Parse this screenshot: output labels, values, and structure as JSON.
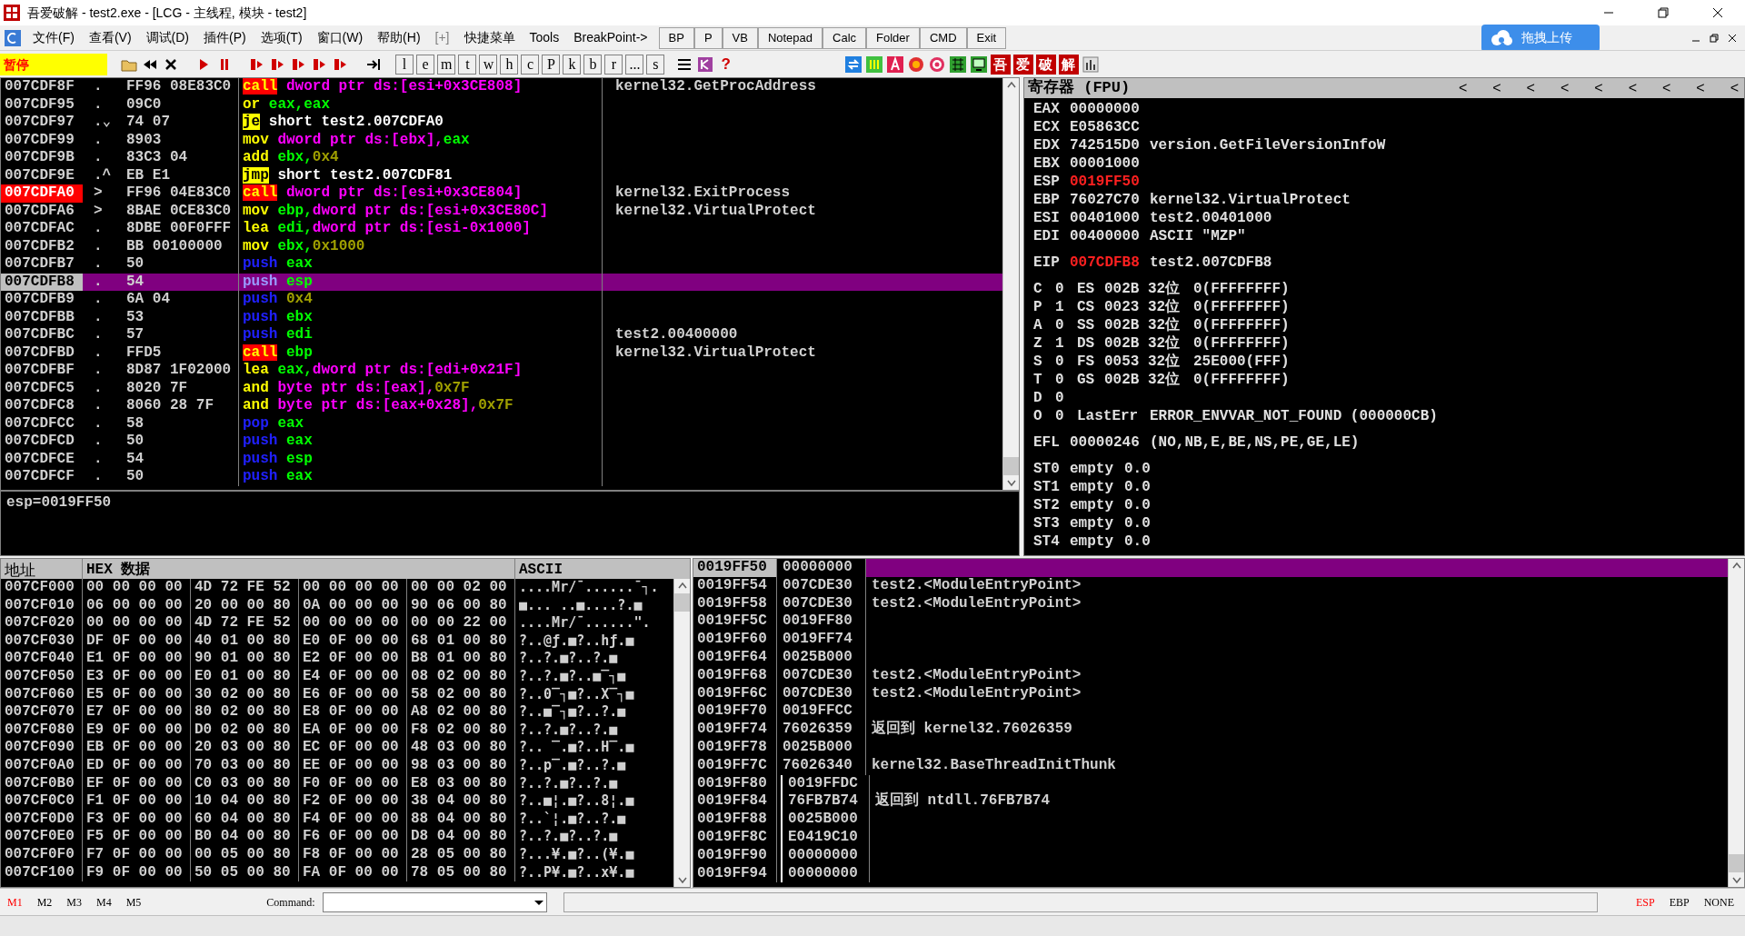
{
  "window": {
    "title": "吾爱破解 - test2.exe - [LCG - 主线程, 模块 - test2]"
  },
  "menu": [
    "文件(F)",
    "查看(V)",
    "调试(D)",
    "插件(P)",
    "选项(T)",
    "窗口(W)",
    "帮助(H)",
    "[+]",
    "快捷菜单",
    "Tools",
    "BreakPoint->"
  ],
  "tool_buttons": [
    "BP",
    "P",
    "VB",
    "Notepad",
    "Calc",
    "Folder",
    "CMD",
    "Exit"
  ],
  "upload_button": "拖拽上传",
  "status": "暂停",
  "letter_buttons": [
    "l",
    "e",
    "m",
    "t",
    "w",
    "h",
    "c",
    "P",
    "k",
    "b",
    "r",
    "...",
    "s"
  ],
  "help_button": "?",
  "cjk_buttons": [
    "吾",
    "爱",
    "破",
    "解"
  ],
  "disassembly": [
    {
      "address": "007CDF8F",
      "mark": ".",
      "hex": "FF96 08E83C0",
      "code": [
        {
          "kind": "call",
          "text": "call"
        },
        {
          "kind": "mem",
          "text": " dword ptr ds:[esi+0x3CE808]"
        }
      ],
      "comment": "kernel32.GetProcAddress",
      "selected": false,
      "breakpoint": false
    },
    {
      "address": "007CDF95",
      "mark": ".",
      "hex": "09C0",
      "code": [
        {
          "kind": "op",
          "text": "or"
        },
        {
          "kind": "reg",
          "text": " eax,eax"
        }
      ],
      "selected": false,
      "breakpoint": false
    },
    {
      "address": "007CDF97",
      "mark": ".⌄",
      "hex": "74 07",
      "code": [
        {
          "kind": "jump",
          "text": "je"
        },
        {
          "kind": "sym",
          "text": " short test2.007CDFA0"
        }
      ],
      "selected": false,
      "breakpoint": false
    },
    {
      "address": "007CDF99",
      "mark": ".",
      "hex": "8903",
      "code": [
        {
          "kind": "op",
          "text": "mov"
        },
        {
          "kind": "mem",
          "text": " dword ptr ds:[ebx],"
        },
        {
          "kind": "reg",
          "text": "eax"
        }
      ],
      "selected": false,
      "breakpoint": false
    },
    {
      "address": "007CDF9B",
      "mark": ".",
      "hex": "83C3 04",
      "code": [
        {
          "kind": "op",
          "text": "add"
        },
        {
          "kind": "reg",
          "text": " ebx,"
        },
        {
          "kind": "imm",
          "text": "0x4"
        }
      ],
      "selected": false,
      "breakpoint": false
    },
    {
      "address": "007CDF9E",
      "mark": ".^",
      "hex": "EB E1",
      "code": [
        {
          "kind": "jump",
          "text": "jmp"
        },
        {
          "kind": "sym",
          "text": " short test2.007CDF81"
        }
      ],
      "selected": false,
      "breakpoint": false
    },
    {
      "address": "007CDFA0",
      "mark": ">",
      "hex": "FF96 04E83C0",
      "code": [
        {
          "kind": "call",
          "text": "call"
        },
        {
          "kind": "mem",
          "text": " dword ptr ds:[esi+0x3CE804]"
        }
      ],
      "comment": "kernel32.ExitProcess",
      "selected": false,
      "breakpoint": true
    },
    {
      "address": "007CDFA6",
      "mark": ">",
      "hex": "8BAE 0CE83C0",
      "code": [
        {
          "kind": "op",
          "text": "mov"
        },
        {
          "kind": "reg",
          "text": " ebp,"
        },
        {
          "kind": "mem",
          "text": "dword ptr ds:[esi+0x3CE80C]"
        }
      ],
      "comment": "kernel32.VirtualProtect",
      "selected": false,
      "breakpoint": false
    },
    {
      "address": "007CDFAC",
      "mark": ".",
      "hex": "8DBE 00F0FFF",
      "code": [
        {
          "kind": "op",
          "text": "lea"
        },
        {
          "kind": "reg",
          "text": " edi,"
        },
        {
          "kind": "mem",
          "text": "dword ptr ds:[esi-0x1000]"
        }
      ],
      "selected": false,
      "breakpoint": false
    },
    {
      "address": "007CDFB2",
      "mark": ".",
      "hex": "BB 00100000",
      "code": [
        {
          "kind": "op",
          "text": "mov"
        },
        {
          "kind": "reg",
          "text": " ebx,"
        },
        {
          "kind": "imm",
          "text": "0x1000"
        }
      ],
      "selected": false,
      "breakpoint": false
    },
    {
      "address": "007CDFB7",
      "mark": ".",
      "hex": "50",
      "code": [
        {
          "kind": "push",
          "text": "push"
        },
        {
          "kind": "reg",
          "text": " eax"
        }
      ],
      "selected": false,
      "breakpoint": false
    },
    {
      "address": "007CDFB8",
      "mark": ".",
      "hex": "54",
      "code": [
        {
          "kind": "push",
          "text": "push"
        },
        {
          "kind": "reg",
          "text": " esp"
        }
      ],
      "selected": true,
      "breakpoint": false
    },
    {
      "address": "007CDFB9",
      "mark": ".",
      "hex": "6A 04",
      "code": [
        {
          "kind": "push",
          "text": "push"
        },
        {
          "kind": "imm",
          "text": " 0x4"
        }
      ],
      "selected": false,
      "breakpoint": false
    },
    {
      "address": "007CDFBB",
      "mark": ".",
      "hex": "53",
      "code": [
        {
          "kind": "push",
          "text": "push"
        },
        {
          "kind": "reg",
          "text": " ebx"
        }
      ],
      "selected": false,
      "breakpoint": false
    },
    {
      "address": "007CDFBC",
      "mark": ".",
      "hex": "57",
      "code": [
        {
          "kind": "push",
          "text": "push"
        },
        {
          "kind": "reg",
          "text": " edi"
        }
      ],
      "comment": "test2.00400000",
      "selected": false,
      "breakpoint": false
    },
    {
      "address": "007CDFBD",
      "mark": ".",
      "hex": "FFD5",
      "code": [
        {
          "kind": "call",
          "text": "call"
        },
        {
          "kind": "reg",
          "text": " ebp"
        }
      ],
      "comment": "kernel32.VirtualProtect",
      "selected": false,
      "breakpoint": false
    },
    {
      "address": "007CDFBF",
      "mark": ".",
      "hex": "8D87 1F02000",
      "code": [
        {
          "kind": "op",
          "text": "lea"
        },
        {
          "kind": "reg",
          "text": " eax,"
        },
        {
          "kind": "mem",
          "text": "dword ptr ds:[edi+0x21F]"
        }
      ],
      "selected": false,
      "breakpoint": false
    },
    {
      "address": "007CDFC5",
      "mark": ".",
      "hex": "8020 7F",
      "code": [
        {
          "kind": "op",
          "text": "and"
        },
        {
          "kind": "mem",
          "text": " byte ptr ds:[eax],"
        },
        {
          "kind": "imm",
          "text": "0x7F"
        }
      ],
      "selected": false,
      "breakpoint": false
    },
    {
      "address": "007CDFC8",
      "mark": ".",
      "hex": "8060 28 7F",
      "code": [
        {
          "kind": "op",
          "text": "and"
        },
        {
          "kind": "mem",
          "text": " byte ptr ds:[eax+0x28],"
        },
        {
          "kind": "imm",
          "text": "0x7F"
        }
      ],
      "selected": false,
      "breakpoint": false
    },
    {
      "address": "007CDFCC",
      "mark": ".",
      "hex": "58",
      "code": [
        {
          "kind": "push",
          "text": "pop"
        },
        {
          "kind": "reg",
          "text": " eax"
        }
      ],
      "selected": false,
      "breakpoint": false
    },
    {
      "address": "007CDFCD",
      "mark": ".",
      "hex": "50",
      "code": [
        {
          "kind": "push",
          "text": "push"
        },
        {
          "kind": "reg",
          "text": " eax"
        }
      ],
      "selected": false,
      "breakpoint": false
    },
    {
      "address": "007CDFCE",
      "mark": ".",
      "hex": "54",
      "code": [
        {
          "kind": "push",
          "text": "push"
        },
        {
          "kind": "reg",
          "text": " esp"
        }
      ],
      "selected": false,
      "breakpoint": false
    },
    {
      "address": "007CDFCF",
      "mark": ".",
      "hex": "50",
      "code": [
        {
          "kind": "push",
          "text": "push"
        },
        {
          "kind": "reg",
          "text": " eax"
        }
      ],
      "selected": false,
      "breakpoint": false
    }
  ],
  "info_pane": "esp=0019FF50",
  "registers": {
    "title": "寄存器 (FPU)",
    "header_arrows": [
      "<",
      "<",
      "<",
      "<",
      "<",
      "<",
      "<",
      "<",
      "<"
    ],
    "general": [
      {
        "name": "EAX",
        "value": "00000000",
        "changed": false
      },
      {
        "name": "ECX",
        "value": "E05863CC",
        "changed": false
      },
      {
        "name": "EDX",
        "value": "742515D0",
        "comment": "version.GetFileVersionInfoW",
        "changed": false
      },
      {
        "name": "EBX",
        "value": "00001000",
        "changed": false
      },
      {
        "name": "ESP",
        "value": "0019FF50",
        "changed": true
      },
      {
        "name": "EBP",
        "value": "76027C70",
        "comment": "kernel32.VirtualProtect",
        "changed": false
      },
      {
        "name": "ESI",
        "value": "00401000",
        "comment": "test2.00401000",
        "changed": false
      },
      {
        "name": "EDI",
        "value": "00400000",
        "comment": "ASCII \"MZP\"",
        "changed": false
      }
    ],
    "eip": {
      "name": "EIP",
      "value": "007CDFB8",
      "comment": "test2.007CDFB8",
      "changed": true
    },
    "flags": [
      {
        "flag": "C",
        "bit": "0",
        "segment": "ES",
        "selector": "002B",
        "bits": "32位",
        "base": "0(FFFFFFFF)"
      },
      {
        "flag": "P",
        "bit": "1",
        "segment": "CS",
        "selector": "0023",
        "bits": "32位",
        "base": "0(FFFFFFFF)"
      },
      {
        "flag": "A",
        "bit": "0",
        "segment": "SS",
        "selector": "002B",
        "bits": "32位",
        "base": "0(FFFFFFFF)"
      },
      {
        "flag": "Z",
        "bit": "1",
        "segment": "DS",
        "selector": "002B",
        "bits": "32位",
        "base": "0(FFFFFFFF)"
      },
      {
        "flag": "S",
        "bit": "0",
        "segment": "FS",
        "selector": "0053",
        "bits": "32位",
        "base": "25E000(FFF)"
      },
      {
        "flag": "T",
        "bit": "0",
        "segment": "GS",
        "selector": "002B",
        "bits": "32位",
        "base": "0(FFFFFFFF)"
      },
      {
        "flag": "D",
        "bit": "0"
      }
    ],
    "last_error": {
      "flag": "O",
      "bit": "0",
      "label": "LastErr",
      "value": "ERROR_ENVVAR_NOT_FOUND (000000CB)"
    },
    "efl": {
      "name": "EFL",
      "value": "00000246",
      "comment": "(NO,NB,E,BE,NS,PE,GE,LE)"
    },
    "fpu": [
      {
        "name": "ST0",
        "tag": "empty",
        "value": "0.0"
      },
      {
        "name": "ST1",
        "tag": "empty",
        "value": "0.0"
      },
      {
        "name": "ST2",
        "tag": "empty",
        "value": "0.0"
      },
      {
        "name": "ST3",
        "tag": "empty",
        "value": "0.0"
      },
      {
        "name": "ST4",
        "tag": "empty",
        "value": "0.0"
      }
    ]
  },
  "dump": {
    "columns": [
      "地址",
      "HEX 数据",
      "ASCII"
    ],
    "rows": [
      {
        "address": "007CF000",
        "groups": [
          "00 00 00 00",
          "4D 72 FE 52",
          "00 00 00 00",
          "00 00 02 00"
        ],
        "ascii": "....Mr/¯......¯┐."
      },
      {
        "address": "007CF010",
        "groups": [
          "06 00 00 00",
          "20 00 00 80",
          "0A 00 00 00",
          "90 06 00 80"
        ],
        "ascii": "■... ..■....?.■"
      },
      {
        "address": "007CF020",
        "groups": [
          "00 00 00 00",
          "4D 72 FE 52",
          "00 00 00 00",
          "00 00 22 00"
        ],
        "ascii": "....Mr/¯......\"."
      },
      {
        "address": "007CF030",
        "groups": [
          "DF 0F 00 00",
          "40 01 00 80",
          "E0 0F 00 00",
          "68 01 00 80"
        ],
        "ascii": "?..@ƒ.■?..hƒ.■"
      },
      {
        "address": "007CF040",
        "groups": [
          "E1 0F 00 00",
          "90 01 00 80",
          "E2 0F 00 00",
          "B8 01 00 80"
        ],
        "ascii": "?..?.■?..?.■"
      },
      {
        "address": "007CF050",
        "groups": [
          "E3 0F 00 00",
          "E0 01 00 80",
          "E4 0F 00 00",
          "08 02 00 80"
        ],
        "ascii": "?..?.■?..■‾┐■"
      },
      {
        "address": "007CF060",
        "groups": [
          "E5 0F 00 00",
          "30 02 00 80",
          "E6 0F 00 00",
          "58 02 00 80"
        ],
        "ascii": "?..0‾┐■?..X‾┐■"
      },
      {
        "address": "007CF070",
        "groups": [
          "E7 0F 00 00",
          "80 02 00 80",
          "E8 0F 00 00",
          "A8 02 00 80"
        ],
        "ascii": "?..■‾┐■?..?.■"
      },
      {
        "address": "007CF080",
        "groups": [
          "E9 0F 00 00",
          "D0 02 00 80",
          "EA 0F 00 00",
          "F8 02 00 80"
        ],
        "ascii": "?..?.■?..?.■"
      },
      {
        "address": "007CF090",
        "groups": [
          "EB 0F 00 00",
          "20 03 00 80",
          "EC 0F 00 00",
          "48 03 00 80"
        ],
        "ascii": "?.. ‾.■?..H‾.■"
      },
      {
        "address": "007CF0A0",
        "groups": [
          "ED 0F 00 00",
          "70 03 00 80",
          "EE 0F 00 00",
          "98 03 00 80"
        ],
        "ascii": "?..p‾.■?..?.■"
      },
      {
        "address": "007CF0B0",
        "groups": [
          "EF 0F 00 00",
          "C0 03 00 80",
          "F0 0F 00 00",
          "E8 03 00 80"
        ],
        "ascii": "?..?.■?..?.■"
      },
      {
        "address": "007CF0C0",
        "groups": [
          "F1 0F 00 00",
          "10 04 00 80",
          "F2 0F 00 00",
          "38 04 00 80"
        ],
        "ascii": "?..■¦.■?..8¦.■"
      },
      {
        "address": "007CF0D0",
        "groups": [
          "F3 0F 00 00",
          "60 04 00 80",
          "F4 0F 00 00",
          "88 04 00 80"
        ],
        "ascii": "?..`¦.■?..?.■"
      },
      {
        "address": "007CF0E0",
        "groups": [
          "F5 0F 00 00",
          "B0 04 00 80",
          "F6 0F 00 00",
          "D8 04 00 80"
        ],
        "ascii": "?..?.■?..?.■"
      },
      {
        "address": "007CF0F0",
        "groups": [
          "F7 0F 00 00",
          "00 05 00 80",
          "F8 0F 00 00",
          "28 05 00 80"
        ],
        "ascii": "?...¥.■?..(¥.■"
      },
      {
        "address": "007CF100",
        "groups": [
          "F9 0F 00 00",
          "50 05 00 80",
          "FA 0F 00 00",
          "78 05 00 80"
        ],
        "ascii": "?..P¥.■?..x¥.■"
      }
    ]
  },
  "stack": [
    {
      "address": "0019FF50",
      "value": "00000000",
      "selected": true,
      "frame": false
    },
    {
      "address": "0019FF54",
      "value": "007CDE30",
      "comment": "test2.<ModuleEntryPoint>",
      "selected": false,
      "frame": false
    },
    {
      "address": "0019FF58",
      "value": "007CDE30",
      "comment": "test2.<ModuleEntryPoint>",
      "selected": false,
      "frame": false
    },
    {
      "address": "0019FF5C",
      "value": "0019FF80",
      "selected": false,
      "frame": false
    },
    {
      "address": "0019FF60",
      "value": "0019FF74",
      "selected": false,
      "frame": false
    },
    {
      "address": "0019FF64",
      "value": "0025B000",
      "selected": false,
      "frame": false
    },
    {
      "address": "0019FF68",
      "value": "007CDE30",
      "comment": "test2.<ModuleEntryPoint>",
      "selected": false,
      "frame": false
    },
    {
      "address": "0019FF6C",
      "value": "007CDE30",
      "comment": "test2.<ModuleEntryPoint>",
      "selected": false,
      "frame": false
    },
    {
      "address": "0019FF70",
      "value": "0019FFCC",
      "selected": false,
      "frame": false
    },
    {
      "address": "0019FF74",
      "value": "76026359",
      "comment": "返回到 kernel32.76026359",
      "selected": false,
      "frame": false
    },
    {
      "address": "0019FF78",
      "value": "0025B000",
      "selected": false,
      "frame": false
    },
    {
      "address": "0019FF7C",
      "value": "76026340",
      "comment": "kernel32.BaseThreadInitThunk",
      "selected": false,
      "frame": false
    },
    {
      "address": "0019FF80",
      "value": "0019FFDC",
      "selected": false,
      "frame": true
    },
    {
      "address": "0019FF84",
      "value": "76FB7B74",
      "comment": "返回到 ntdll.76FB7B74",
      "selected": false,
      "frame": true
    },
    {
      "address": "0019FF88",
      "value": "0025B000",
      "selected": false,
      "frame": true
    },
    {
      "address": "0019FF8C",
      "value": "E0419C10",
      "selected": false,
      "frame": true
    },
    {
      "address": "0019FF90",
      "value": "00000000",
      "selected": false,
      "frame": true
    },
    {
      "address": "0019FF94",
      "value": "00000000",
      "selected": false,
      "frame": true
    }
  ],
  "memory_tabs": [
    {
      "label": "M1",
      "selected": true
    },
    {
      "label": "M2",
      "selected": false
    },
    {
      "label": "M3",
      "selected": false
    },
    {
      "label": "M4",
      "selected": false
    },
    {
      "label": "M5",
      "selected": false
    }
  ],
  "command": {
    "label": "Command:"
  },
  "stack_modes": [
    {
      "label": "ESP",
      "selected": true
    },
    {
      "label": "EBP",
      "selected": false
    },
    {
      "label": "NONE",
      "selected": false
    }
  ]
}
